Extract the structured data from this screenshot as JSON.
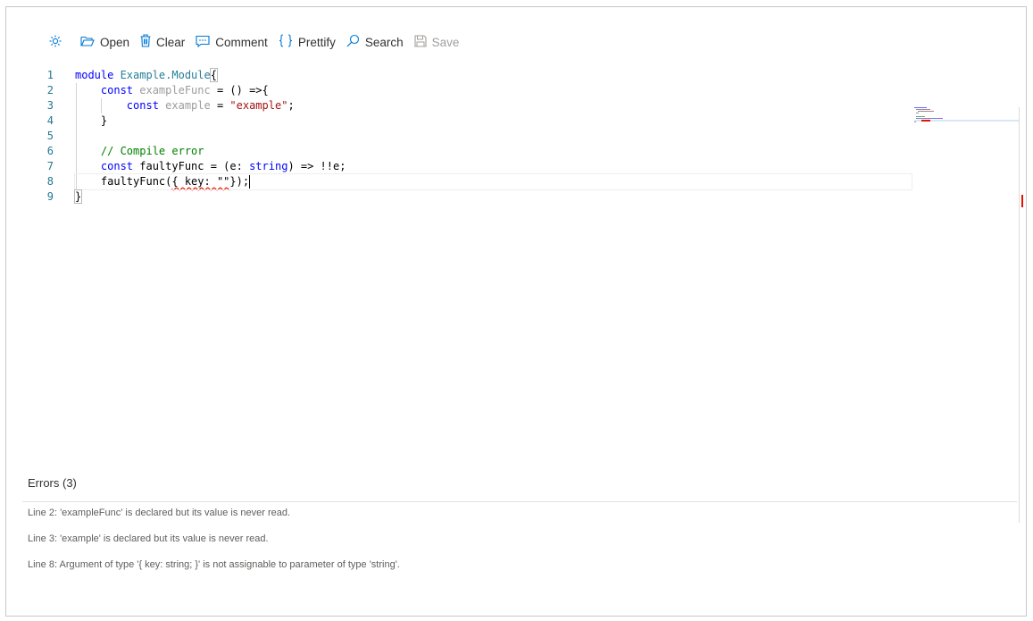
{
  "toolbar": {
    "open_label": "Open",
    "clear_label": "Clear",
    "comment_label": "Comment",
    "prettify_label": "Prettify",
    "search_label": "Search",
    "save_label": "Save",
    "icons": [
      "sun-icon",
      "folder-open-icon",
      "trash-icon",
      "comment-icon",
      "braces-icon",
      "search-icon",
      "save-icon"
    ]
  },
  "editor": {
    "line_numbers": [
      "1",
      "2",
      "3",
      "4",
      "5",
      "6",
      "7",
      "8",
      "9"
    ],
    "lines": [
      "module Example.Module{",
      "    const exampleFunc = () =>{",
      "        const example = \"example\";",
      "    }",
      "",
      "    // Compile error",
      "    const faultyFunc = (e: string) => !!e;",
      "    faultyFunc({ key: \"\"});",
      "}"
    ],
    "tokens": {
      "l1_kw": "module",
      "l1_name": " Example.Module",
      "l1_brace": "{",
      "l2_indent": "    ",
      "l2_kw": "const",
      "l2_name": " exampleFunc",
      "l2_rest": " = () =>{",
      "l3_indent": "        ",
      "l3_kw": "const",
      "l3_name": " example",
      "l3_eq": " = ",
      "l3_str": "\"example\"",
      "l3_semi": ";",
      "l4_text": "    }",
      "l6_indent": "    ",
      "l6_cmt": "// Compile error",
      "l7_indent": "    ",
      "l7_kw": "const",
      "l7_a": " faultyFunc = (e: ",
      "l7_type": "string",
      "l7_b": ") => !!e;",
      "l8_a": "    faultyFunc(",
      "l8_err": "{ key: \"\"",
      "l8_b": "});",
      "l9_brace": "}"
    },
    "cursor_line": 8,
    "colors": {
      "keyword": "#0000ff",
      "type": "#267f99",
      "string": "#a31515",
      "comment": "#008000",
      "line_number": "#237893",
      "error": "#e51400"
    }
  },
  "errors": {
    "title": "Errors (3)",
    "items": [
      "Line 2: 'exampleFunc' is declared but its value is never read.",
      "Line 3: 'example' is declared but its value is never read.",
      "Line 8: Argument of type '{ key: string; }' is not assignable to parameter of type 'string'."
    ]
  }
}
